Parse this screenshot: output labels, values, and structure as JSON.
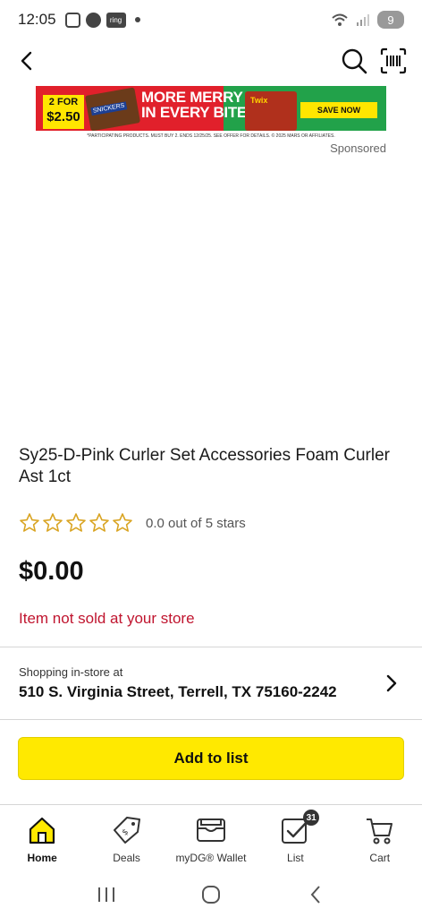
{
  "status_bar": {
    "time": "12:05",
    "ring_label": "ring",
    "battery": "9"
  },
  "ad": {
    "price_top": "2 FOR",
    "price_bottom": "$2.50",
    "candy_left_label": "SNICKERS",
    "headline_line1": "MORE MERRY",
    "headline_line2": "IN EVERY BITE",
    "candy_right_label": "Twix",
    "cta": "SAVE NOW",
    "fine_print": "*PARTICIPATING PRODUCTS. MUST BUY 2. ENDS 12/25/25. SEE OFFER FOR DETAILS. © 2025 MARS OR AFFILIATES.",
    "sponsored": "Sponsored",
    "colors": {
      "red": "#e1202b",
      "green": "#22a24a",
      "yellow": "#ffe600"
    }
  },
  "product": {
    "title": "Sy25-D-Pink Curler Set Accessories Foam Curler Ast 1ct",
    "rating_text": "0.0 out of 5 stars",
    "rating_value": 0,
    "rating_max": 5,
    "price": "$0.00",
    "availability": "Item not sold at your store"
  },
  "store": {
    "label": "Shopping in-store at",
    "address": "510 S. Virginia Street, Terrell, TX 75160-2242"
  },
  "actions": {
    "add_to_list": "Add to list"
  },
  "bottom_nav": {
    "home": "Home",
    "deals": "Deals",
    "wallet": "myDG® Wallet",
    "list": "List",
    "list_badge": "31",
    "cart": "Cart"
  },
  "colors": {
    "brand_yellow": "#ffe900",
    "error_red": "#c0152f",
    "star_gold": "#d9a422"
  }
}
